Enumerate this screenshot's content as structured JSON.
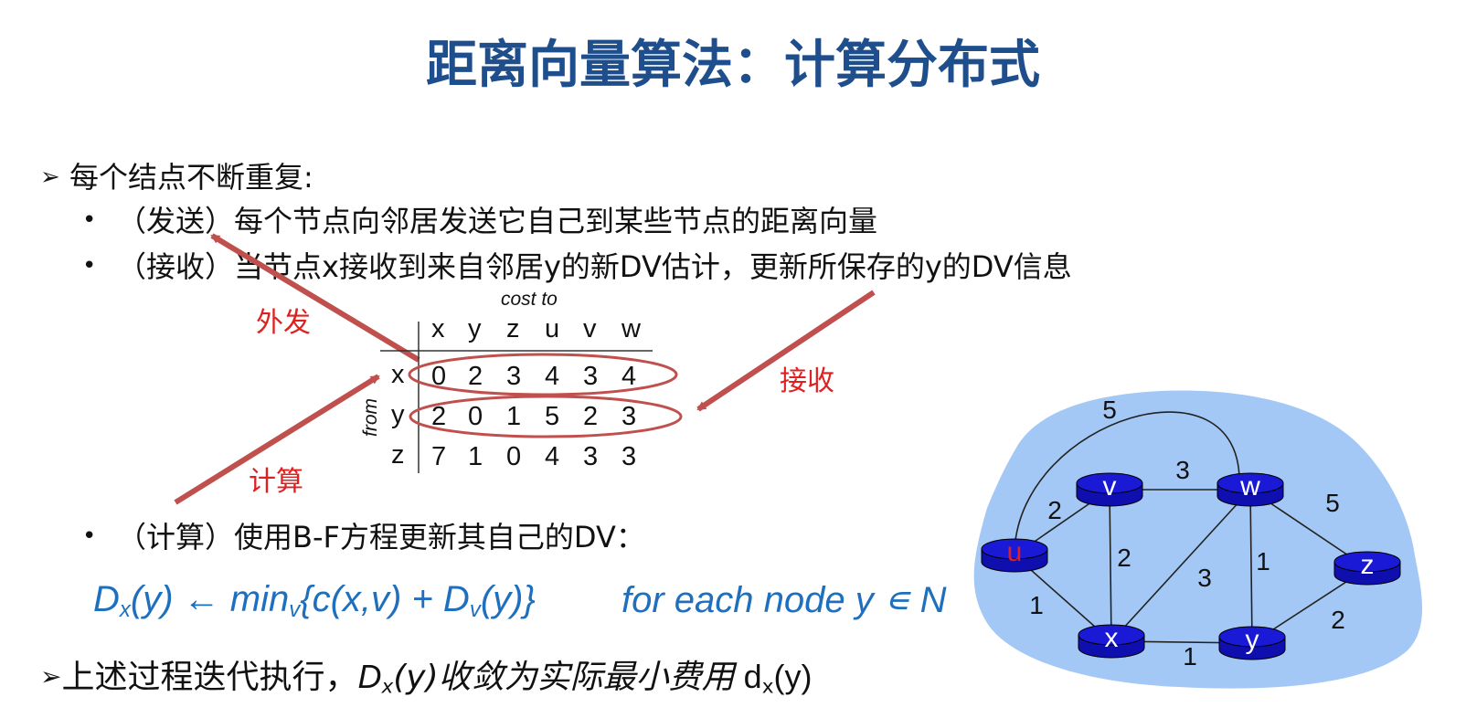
{
  "title": "距离向量算法：计算分布式",
  "point1": {
    "marker": "➢",
    "text": "每个结点不断重复:"
  },
  "sub_items": [
    {
      "bullet": "•",
      "text": "（发送）每个节点向邻居发送它自己到某些节点的距离向量"
    },
    {
      "bullet": "•",
      "text": "（接收）当节点x接收到来自邻居y的新DV估计，更新所保存的y的DV信息"
    },
    {
      "bullet": "•",
      "text": "（计算）使用B-F方程更新其自己的DV："
    }
  ],
  "labels": {
    "send": "外发",
    "receive": "接收",
    "compute": "计算"
  },
  "dv_table": {
    "cost_to_label": "cost to",
    "from_label": "from",
    "columns": [
      "x",
      "y",
      "z",
      "u",
      "v",
      "w"
    ],
    "rows": [
      {
        "label": "x",
        "values": [
          "0",
          "2",
          "3",
          "4",
          "3",
          "4"
        ]
      },
      {
        "label": "y",
        "values": [
          "2",
          "0",
          "1",
          "5",
          "2",
          "3"
        ]
      },
      {
        "label": "z",
        "values": [
          "7",
          "1",
          "0",
          "4",
          "3",
          "3"
        ]
      }
    ]
  },
  "formula": {
    "D": "D",
    "x_sub": "x",
    "arg_y": "(y) ← min",
    "v_sub": "v",
    "mid": "{c(x,v) + D",
    "v_sub2": "v",
    "end": "(y)}",
    "for_each": "for each node y ∊ N"
  },
  "point2": {
    "marker": "➢",
    "text": "上述过程迭代执行，",
    "D": "D",
    "x_sub": "x",
    "italic_rest": "(y)收敛为实际最小费用",
    "plain_d": " d",
    "plain_x_sub": "x",
    "plain_end": "(y)"
  },
  "network": {
    "background_color": "#a3c8f5",
    "router_color": "#1a1ad6",
    "nodes": [
      {
        "id": "u",
        "label": "u",
        "label_color": "#e02020"
      },
      {
        "id": "v",
        "label": "v",
        "label_color": "#ffffff"
      },
      {
        "id": "w",
        "label": "w",
        "label_color": "#ffffff"
      },
      {
        "id": "x",
        "label": "x",
        "label_color": "#ffffff"
      },
      {
        "id": "y",
        "label": "y",
        "label_color": "#ffffff"
      },
      {
        "id": "z",
        "label": "z",
        "label_color": "#ffffff"
      }
    ],
    "links": [
      {
        "from": "u",
        "to": "w",
        "cost": "5"
      },
      {
        "from": "u",
        "to": "v",
        "cost": "2"
      },
      {
        "from": "u",
        "to": "x",
        "cost": "1"
      },
      {
        "from": "v",
        "to": "w",
        "cost": "3"
      },
      {
        "from": "v",
        "to": "x",
        "cost": "2"
      },
      {
        "from": "w",
        "to": "x",
        "cost": "3"
      },
      {
        "from": "w",
        "to": "y",
        "cost": "1"
      },
      {
        "from": "w",
        "to": "z",
        "cost": "5"
      },
      {
        "from": "x",
        "to": "y",
        "cost": "1"
      },
      {
        "from": "y",
        "to": "z",
        "cost": "2"
      }
    ]
  }
}
